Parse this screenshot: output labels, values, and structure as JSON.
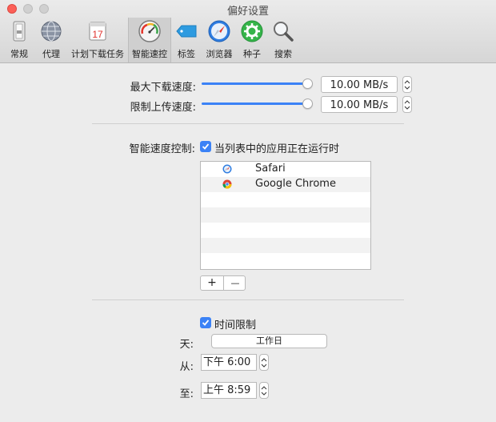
{
  "window": {
    "title": "偏好设置"
  },
  "toolbar": {
    "items": [
      {
        "label": "常规",
        "icon": "general-switch-icon"
      },
      {
        "label": "代理",
        "icon": "network-globe-icon"
      },
      {
        "label": "计划下载任务",
        "icon": "calendar-icon",
        "calendar_day": "17"
      },
      {
        "label": "智能速控",
        "icon": "speedometer-icon"
      },
      {
        "label": "标签",
        "icon": "tag-icon"
      },
      {
        "label": "浏览器",
        "icon": "compass-icon"
      },
      {
        "label": "种子",
        "icon": "seed-gear-icon"
      },
      {
        "label": "搜索",
        "icon": "magnifier-icon"
      }
    ],
    "selected": "智能速控"
  },
  "speed": {
    "max_download_label": "最大下载速度:",
    "max_download_value": "10.00 MB/s",
    "max_download_level": 1.0,
    "upload_limit_label": "限制上传速度:",
    "upload_limit_value": "10.00 MB/s",
    "upload_limit_level": 1.0
  },
  "smart": {
    "label": "智能速度控制:",
    "checkbox_label": "当列表中的应用正在运行时",
    "checked": true,
    "apps": [
      {
        "name": "Safari",
        "icon": "safari-icon"
      },
      {
        "name": "Google Chrome",
        "icon": "chrome-icon"
      }
    ],
    "add_label": "+",
    "remove_label": "—"
  },
  "schedule": {
    "checkbox_label": "时间限制",
    "checked": true,
    "day_label": "天:",
    "day_value": "工作日",
    "from_label": "从:",
    "from_value": "下午  6:00",
    "to_label": "至:",
    "to_value": "上午  8:59"
  },
  "colors": {
    "accent": "#3b82f6",
    "close": "#fc5f57"
  }
}
